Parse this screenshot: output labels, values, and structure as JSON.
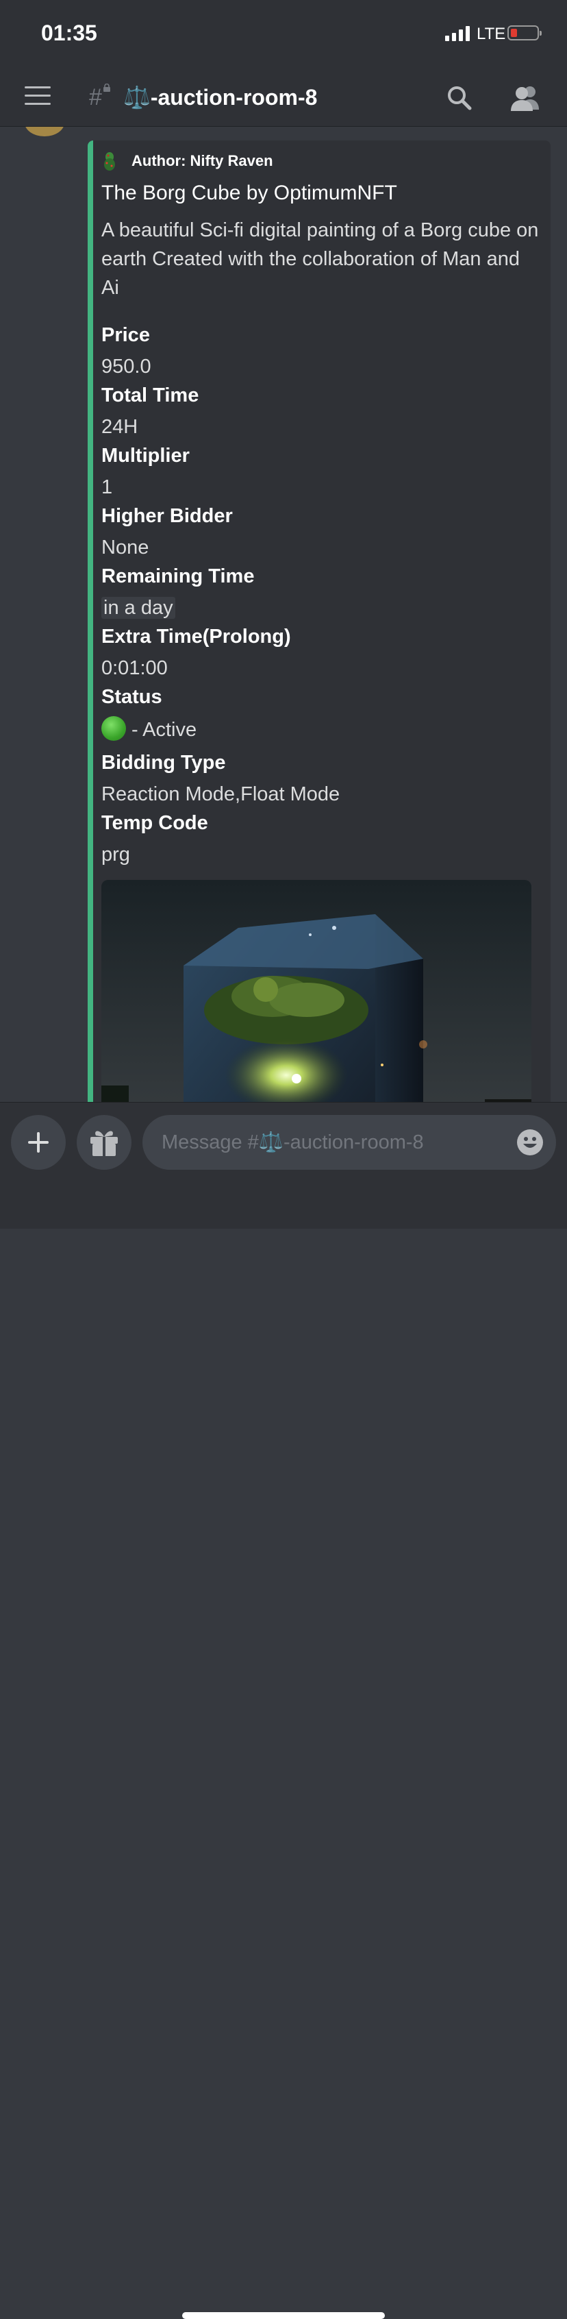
{
  "status_bar": {
    "time": "01:35",
    "network": "LTE",
    "battery_color": "#e03c31"
  },
  "header": {
    "channel_name": "⚖️-auction-room-8"
  },
  "embed": {
    "accent_color": "#43b581",
    "author": "Author: Nifty Raven",
    "title": "The Borg Cube by OptimumNFT",
    "description": "A beautiful Sci-fi digital painting of a Borg cube on earth Created with the collaboration of Man and Ai",
    "fields": {
      "price": {
        "name": "Price",
        "value": "950.0"
      },
      "total_time": {
        "name": "Total Time",
        "value": "24H"
      },
      "multiplier": {
        "name": "Multiplier",
        "value": "1"
      },
      "higher_bidder": {
        "name": "Higher Bidder",
        "value": "None"
      },
      "remaining_time": {
        "name": "Remaining Time",
        "value": "in a day"
      },
      "extra_time": {
        "name": "Extra Time(Prolong)",
        "value": "0:01:00"
      },
      "status": {
        "name": "Status",
        "value": "- Active"
      },
      "bidding_type": {
        "name": "Bidding Type",
        "value": "Reaction Mode,Float Mode"
      },
      "temp_code": {
        "name": "Temp Code",
        "value": "prg"
      }
    }
  },
  "composer": {
    "placeholder": "Message #⚖️-auction-room-8"
  }
}
